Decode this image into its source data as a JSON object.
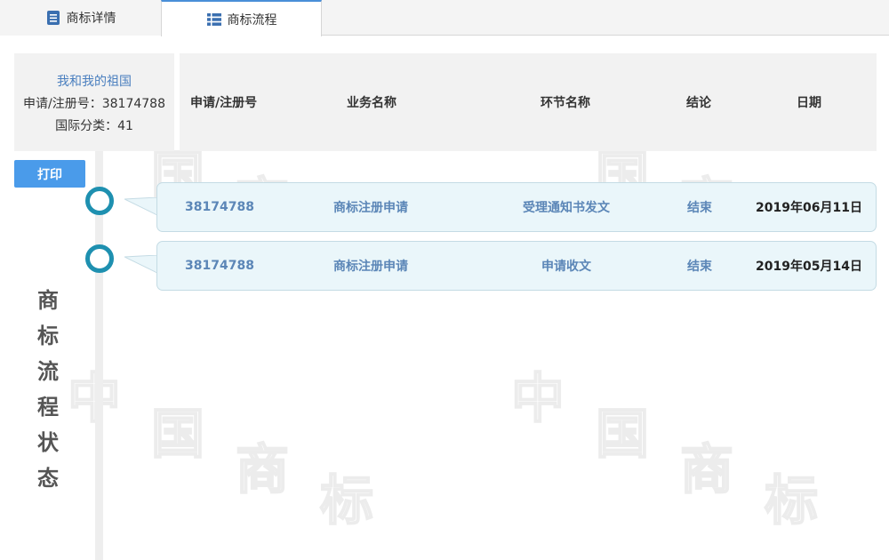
{
  "tabs": [
    {
      "label": "商标详情",
      "icon": "document-icon"
    },
    {
      "label": "商标流程",
      "icon": "list-icon"
    }
  ],
  "mark": {
    "name": "我和我的祖国",
    "reg_no_line": "申请/注册号：38174788",
    "class_line": "国际分类：41"
  },
  "header": {
    "col_no": "申请/注册号",
    "col_business": "业务名称",
    "col_step": "环节名称",
    "col_result": "结论",
    "col_date": "日期"
  },
  "print_label": "打印",
  "side_label": [
    "商",
    "标",
    "流",
    "程",
    "状",
    "态"
  ],
  "watermark": [
    "中",
    "国",
    "商",
    "标"
  ],
  "rows": [
    {
      "no": "38174788",
      "business": "商标注册申请",
      "step": "受理通知书发文",
      "result": "结束",
      "date": "2019年06月11日"
    },
    {
      "no": "38174788",
      "business": "商标注册申请",
      "step": "申请收文",
      "result": "结束",
      "date": "2019年05月14日"
    }
  ],
  "colors": {
    "accent": "#4a9bea",
    "node": "#1e90b0",
    "card_bg": "#eaf6fa"
  }
}
